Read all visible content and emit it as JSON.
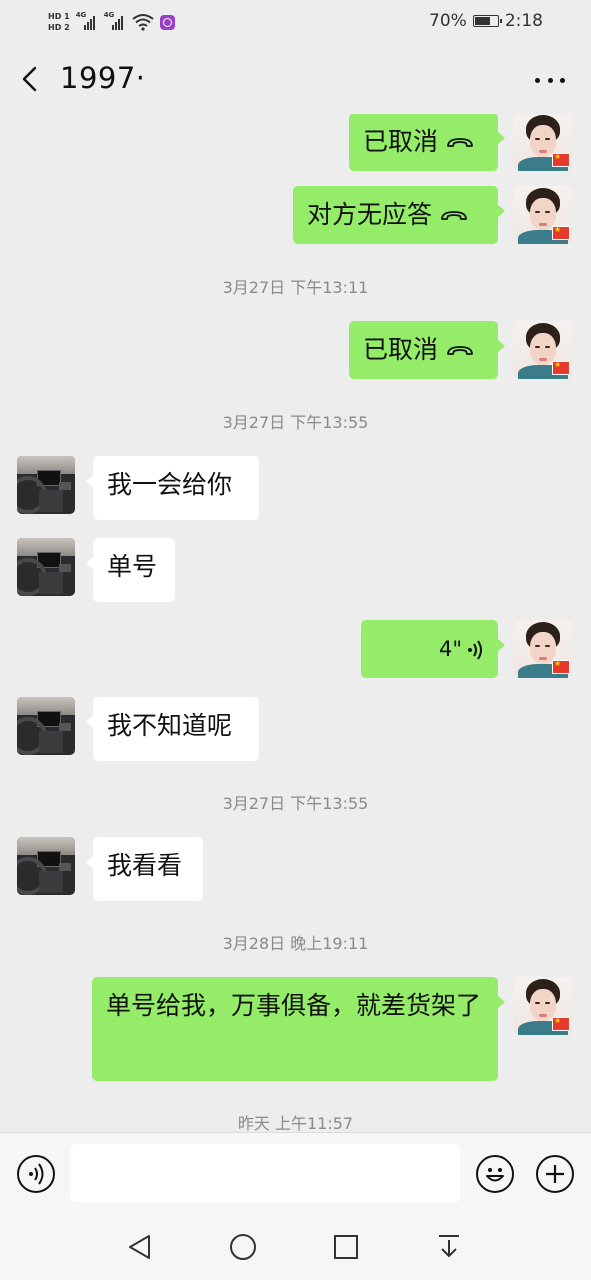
{
  "status_bar": {
    "hd1": "HD 1",
    "hd2": "HD 2",
    "signal1_label": "4G",
    "signal2_label": "4G",
    "battery": "70%",
    "battery_level": 0.7,
    "time": "2:18"
  },
  "header": {
    "title": "1997·",
    "back_icon": "chevron-left-icon",
    "more_icon": "more-dots-icon"
  },
  "messages": [
    {
      "type": "out",
      "kind": "call",
      "text": "已取消"
    },
    {
      "type": "out",
      "kind": "call",
      "text": "对方无应答"
    },
    {
      "type": "timestamp",
      "text": "3月27日 下午13:11"
    },
    {
      "type": "out",
      "kind": "call",
      "text": "已取消"
    },
    {
      "type": "timestamp",
      "text": "3月27日 下午13:55"
    },
    {
      "type": "in",
      "kind": "text",
      "text": "我一会给你"
    },
    {
      "type": "in",
      "kind": "text",
      "text": "单号"
    },
    {
      "type": "out",
      "kind": "voice",
      "text": "4\""
    },
    {
      "type": "in",
      "kind": "text",
      "text": "我不知道呢"
    },
    {
      "type": "timestamp",
      "text": "3月27日 下午13:55"
    },
    {
      "type": "in",
      "kind": "text",
      "text": "我看看"
    },
    {
      "type": "timestamp",
      "text": "3月28日 晚上19:11"
    },
    {
      "type": "out",
      "kind": "text",
      "text": "单号给我，万事俱备，就差货架了"
    },
    {
      "type": "timestamp",
      "text": "昨天 上午11:57"
    }
  ],
  "input_bar": {
    "value": "",
    "voice_icon": "voice-input-icon",
    "emoji_icon": "emoji-icon",
    "plus_icon": "plus-icon"
  },
  "nav_bar": {
    "icons": [
      "back-triangle-icon",
      "home-circle-icon",
      "recents-square-icon",
      "notification-pull-icon"
    ]
  }
}
